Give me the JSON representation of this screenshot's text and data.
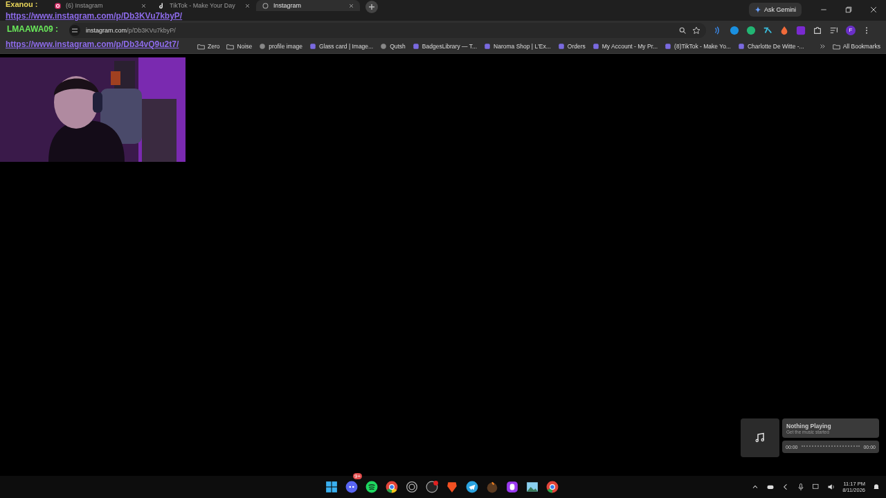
{
  "tabs": [
    {
      "title": "(6) Instagram",
      "selected": false
    },
    {
      "title": "TikTok - Make Your Day",
      "selected": false
    },
    {
      "title": "Instagram",
      "selected": true
    }
  ],
  "ask_gemini": "Ask Gemini",
  "address_bar": {
    "host": "instagram.com",
    "path": "/p/Db3KVu7kbyP/"
  },
  "profile_initial": "F",
  "bookmarks": [
    {
      "title": "Zero",
      "kind": "folder"
    },
    {
      "title": "Noise",
      "kind": "folder"
    },
    {
      "title": "profile image",
      "kind": "globe"
    },
    {
      "title": "Glass card | Image...",
      "kind": "site"
    },
    {
      "title": "Qutsh",
      "kind": "globe"
    },
    {
      "title": "BadgesLibrary — T...",
      "kind": "site"
    },
    {
      "title": "Naroma Shop | L'Ex...",
      "kind": "site"
    },
    {
      "title": "Orders",
      "kind": "site"
    },
    {
      "title": "My Account - My Pr...",
      "kind": "site"
    },
    {
      "title": "(8)TikTok - Make Yo...",
      "kind": "site"
    },
    {
      "title": "Charlotte De Witte -...",
      "kind": "site"
    }
  ],
  "all_bookmarks": "All Bookmarks",
  "chat_overlay": [
    {
      "user": "Exanou :",
      "message": "https://www.instagram.com/p/Db3KVu7kbyP/"
    },
    {
      "user": "LMAAWA09 :",
      "message": "https://www.instagram.com/p/Db34vQ9u2t7/"
    }
  ],
  "media_widget": {
    "title": "Nothing Playing",
    "subtitle": "Get the music started",
    "elapsed": "00:00",
    "total": "00:00"
  },
  "taskbar": {
    "discord_badge": "9+",
    "time": "11:17 PM",
    "date": "8/11/2026"
  }
}
